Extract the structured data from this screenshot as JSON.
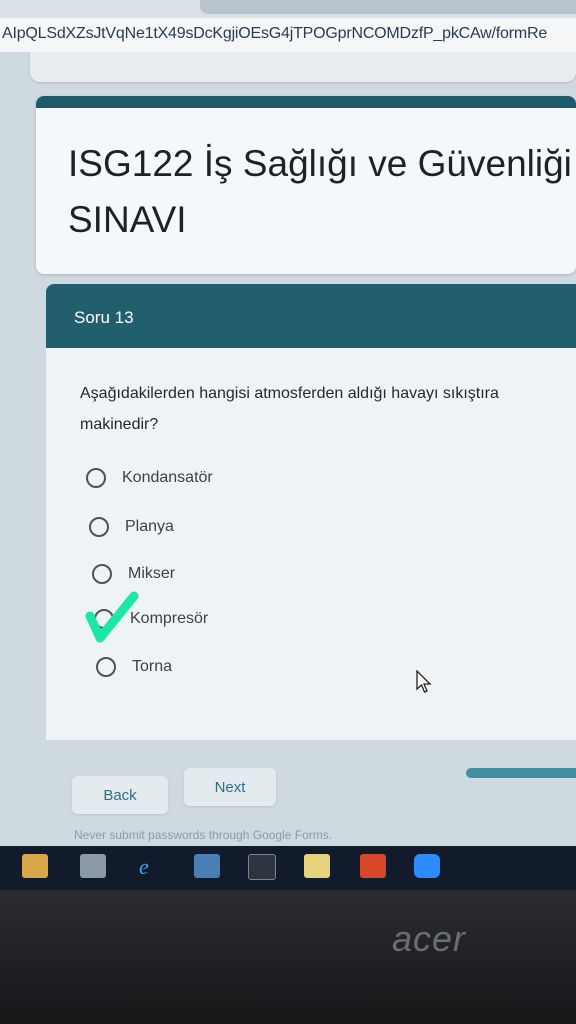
{
  "browser": {
    "url": "AIpQLSdXZsJtVqNe1tX49sDcKgjiOEsG4jTPOGprNCOMDzfP_pkCAw/formRe"
  },
  "form": {
    "title_line1": "ISG122 İş Sağlığı ve Güvenliği",
    "title_line2": "SINAVI",
    "section_label": "Soru 13",
    "question_line1": "Aşağıdakilerden hangisi atmosferden aldığı havayı sıkıştıra",
    "question_line2": "makinedir?",
    "options": [
      {
        "label": "Kondansatör",
        "selected": false
      },
      {
        "label": "Planya",
        "selected": false
      },
      {
        "label": "Mikser",
        "selected": false
      },
      {
        "label": "Kompresör",
        "selected": true
      },
      {
        "label": "Torna",
        "selected": false
      }
    ],
    "back_label": "Back",
    "next_label": "Next",
    "notice": "Never submit passwords through Google Forms.",
    "accent_color": "#215f6e",
    "check_color": "#1ee6a8"
  },
  "taskbar": {
    "icons": [
      "file-explorer-icon",
      "store-icon",
      "internet-explorer-icon",
      "network-icon",
      "terminal-icon",
      "photos-icon",
      "office-icon",
      "zoom-icon"
    ]
  },
  "device": {
    "brand": "acer"
  }
}
